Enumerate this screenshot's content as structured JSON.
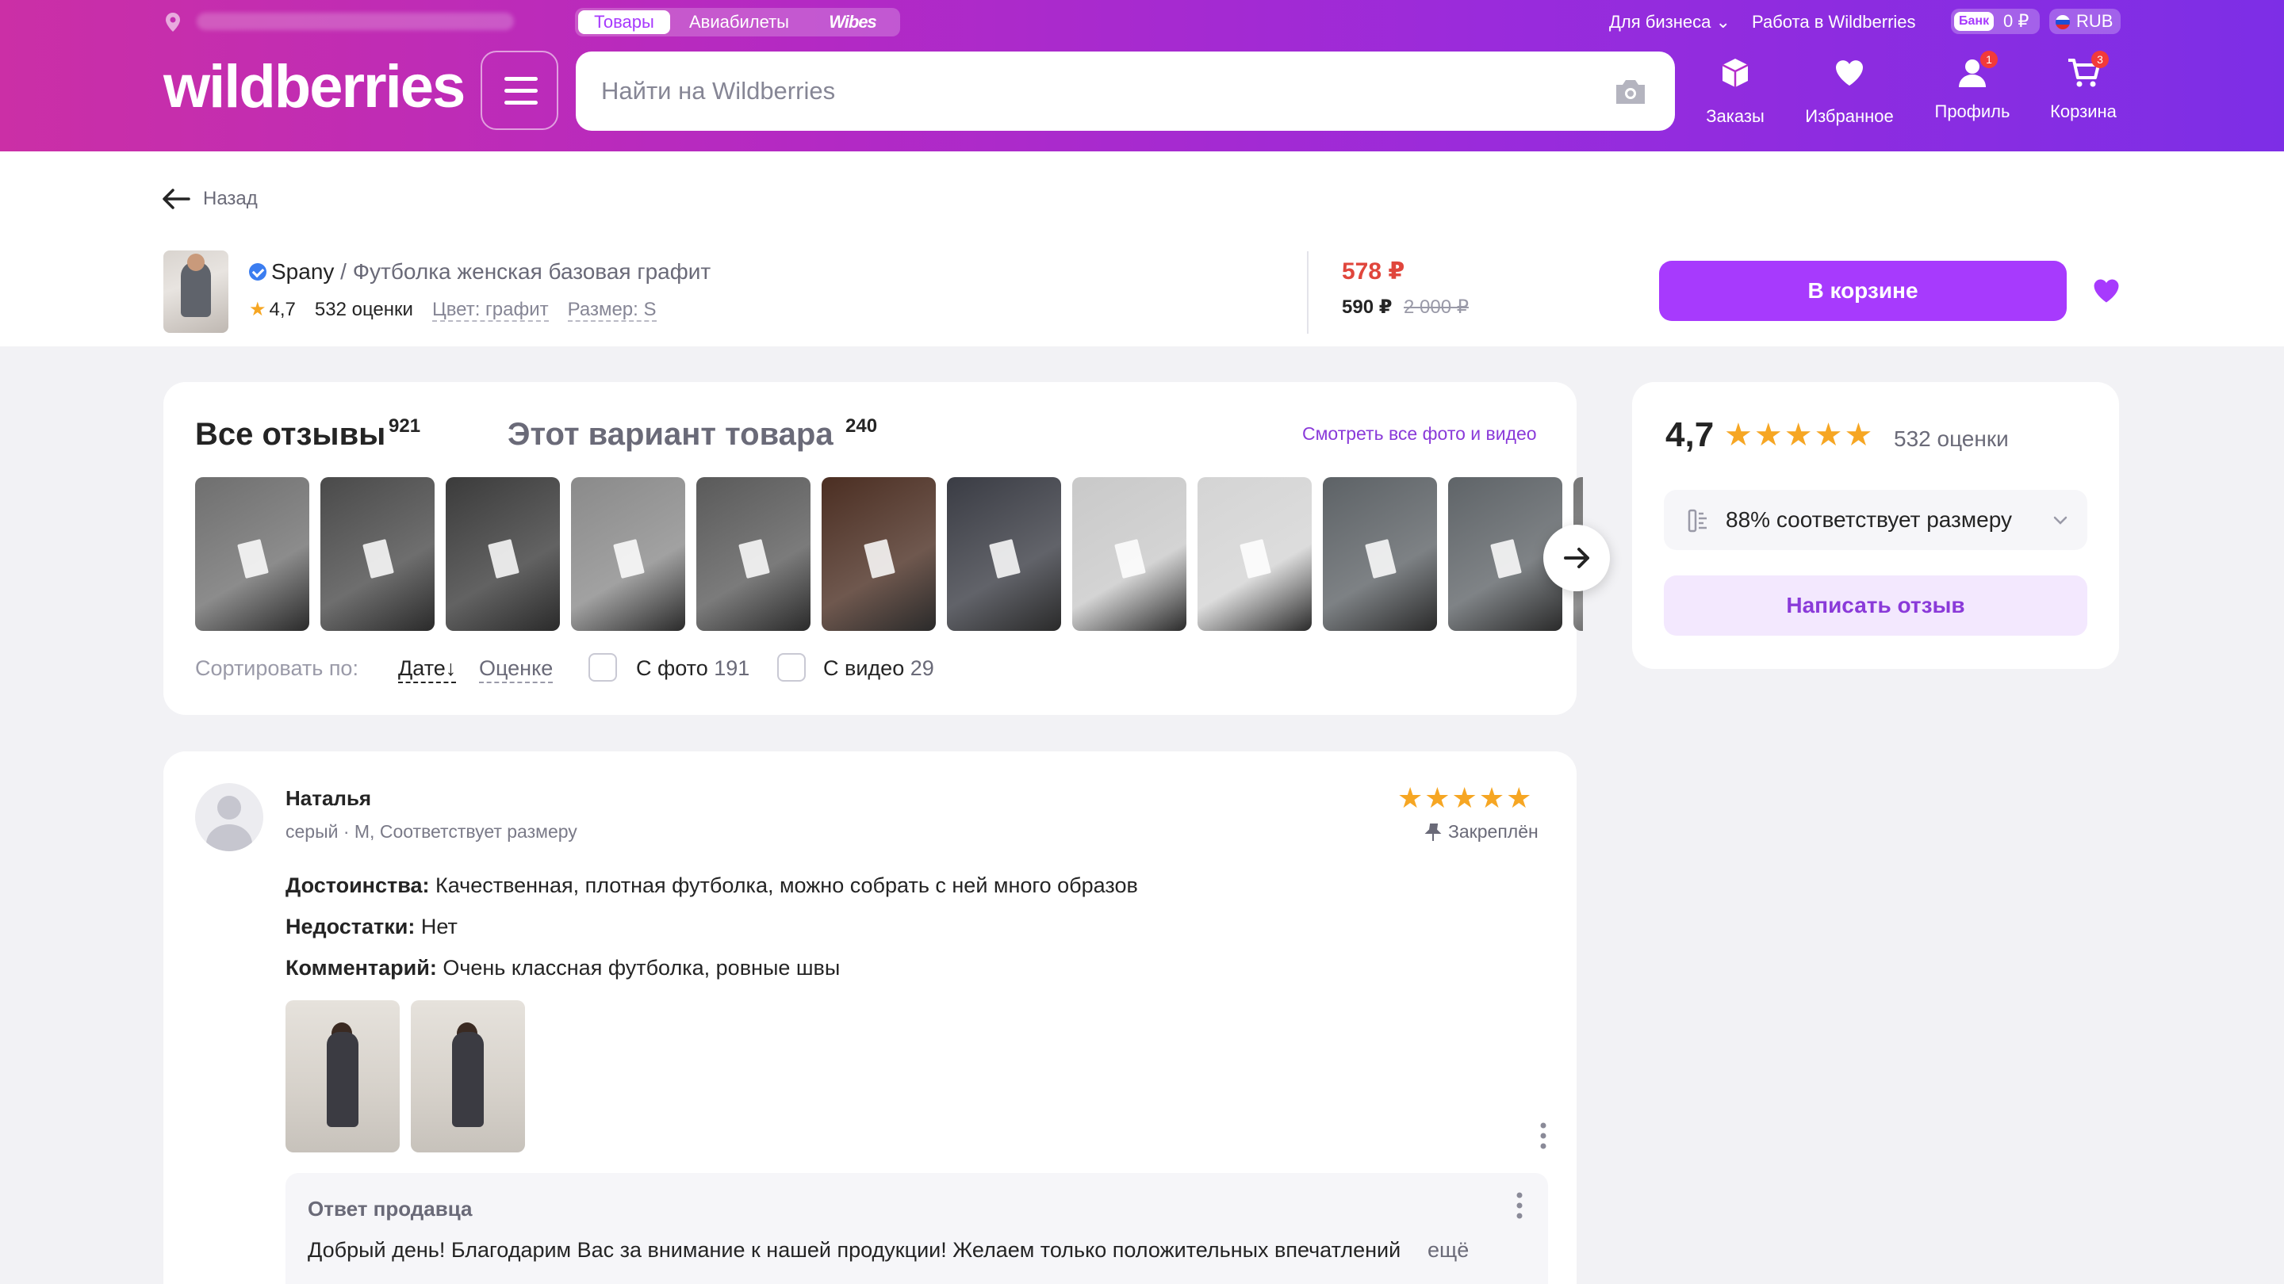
{
  "topbar": {
    "segments": [
      "Товары",
      "Авиабилеты",
      "Wibes"
    ],
    "for_business": "Для бизнеса",
    "work": "Работа в Wildberries",
    "bank_tag": "Банк",
    "bank_balance": "0 ₽",
    "currency": "RUB"
  },
  "header": {
    "logo": "wildberries",
    "search_placeholder": "Найти на Wildberries",
    "nav": {
      "orders": "Заказы",
      "favorites": "Избранное",
      "profile": "Профиль",
      "profile_badge": "1",
      "cart": "Корзина",
      "cart_badge": "3"
    }
  },
  "product": {
    "back": "Назад",
    "brand": "Spany",
    "separator": " / ",
    "name": "Футболка женская базовая графит",
    "rating": "4,7",
    "rating_count": "532 оценки",
    "color": "Цвет: графит",
    "size": "Размер: S",
    "price_now": "578 ₽",
    "price_wallet": "590 ₽",
    "price_old": "2 000 ₽",
    "cart_button": "В корзине"
  },
  "reviews": {
    "tab_all": "Все отзывы",
    "tab_all_count": "921",
    "tab_variant": "Этот вариант товара",
    "tab_variant_count": "240",
    "see_all": "Смотреть все фото и видео",
    "sort_label": "Сортировать по:",
    "sort_date": "Дате↓",
    "sort_score": "Оценке",
    "filter_photo": "С фото",
    "filter_photo_count": "191",
    "filter_video": "С видео",
    "filter_video_count": "29",
    "photo_colors": [
      "#6f6f6f",
      "#4a4a4a",
      "#3b3b3b",
      "#8a8a8a",
      "#5a5a5a",
      "#4b2e22",
      "#3a3c44",
      "#c9c9c9",
      "#d4d4d4",
      "#5d6266",
      "#5f6468",
      "#777777"
    ]
  },
  "rating_card": {
    "value": "4,7",
    "stars": "★★★★★",
    "count": "532 оценки",
    "fit": "88% соответствует размеру",
    "write_button": "Написать отзыв"
  },
  "review_item": {
    "author": "Наталья",
    "meta": "серый · M, Соответствует размеру",
    "stars": "★★★★★",
    "pinned": "Закреплён",
    "pros_label": "Достоинства:",
    "pros": " Качественная, плотная футболка, можно собрать с ней много образов",
    "cons_label": "Недостатки:",
    "cons": " Нет",
    "comment_label": "Комментарий:",
    "comment": " Очень классная футболка, ровные швы",
    "reply_title": "Ответ продавца",
    "reply_text": "Добрый день! Благодарим Вас за внимание к нашей продукции! Желаем только положительных впечатлений",
    "reply_more": "ещё"
  },
  "colors": {
    "accent": "#a73afd",
    "header_start": "#cb2fa6",
    "header_end": "#7d2ee6",
    "price_red": "#e0463c",
    "star": "#f6a623"
  }
}
